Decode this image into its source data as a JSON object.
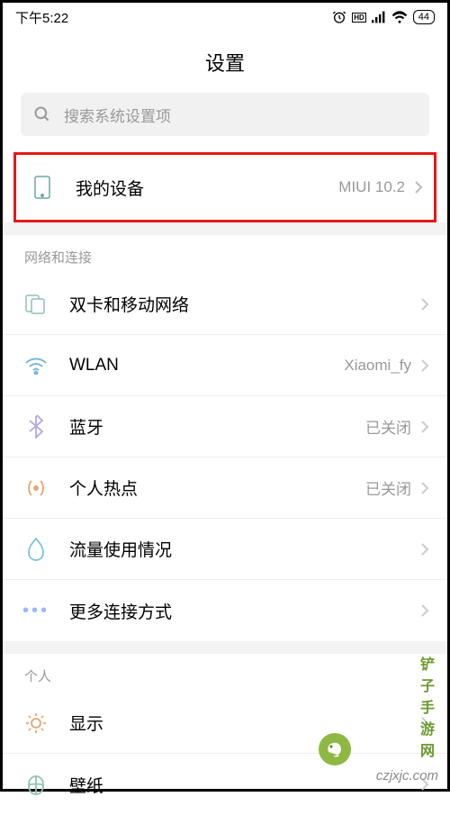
{
  "status": {
    "time": "下午5:22",
    "battery": "44"
  },
  "pageTitle": "设置",
  "search": {
    "placeholder": "搜索系统设置项"
  },
  "deviceRow": {
    "label": "我的设备",
    "value": "MIUI 10.2"
  },
  "section1": {
    "header": "网络和连接",
    "items": [
      {
        "icon": "sim",
        "label": "双卡和移动网络",
        "value": ""
      },
      {
        "icon": "wifi",
        "label": "WLAN",
        "value": "Xiaomi_fy"
      },
      {
        "icon": "bluetooth",
        "label": "蓝牙",
        "value": "已关闭"
      },
      {
        "icon": "hotspot",
        "label": "个人热点",
        "value": "已关闭"
      },
      {
        "icon": "data",
        "label": "流量使用情况",
        "value": ""
      },
      {
        "icon": "more",
        "label": "更多连接方式",
        "value": ""
      }
    ]
  },
  "section2": {
    "header": "个人",
    "items": [
      {
        "icon": "display",
        "label": "显示",
        "value": ""
      },
      {
        "icon": "wallpaper",
        "label": "壁纸",
        "value": ""
      }
    ]
  },
  "watermark": {
    "brand": "铲子手游网",
    "url": "czjxjc.com"
  }
}
